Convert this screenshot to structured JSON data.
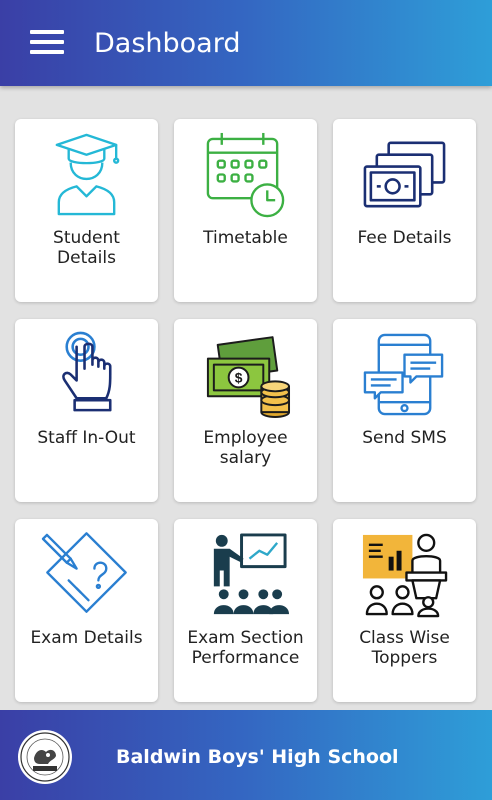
{
  "header": {
    "title": "Dashboard",
    "menu_icon": "hamburger-menu-icon"
  },
  "tiles": [
    {
      "label": "Student\nDetails",
      "icon": "student-graduate-icon"
    },
    {
      "label": "Timetable",
      "icon": "calendar-clock-icon"
    },
    {
      "label": "Fee Details",
      "icon": "money-bills-icon"
    },
    {
      "label": "Staff In-Out",
      "icon": "finger-touch-icon"
    },
    {
      "label": "Employee\nsalary",
      "icon": "cash-coins-icon"
    },
    {
      "label": "Send SMS",
      "icon": "mobile-chat-icon"
    },
    {
      "label": "Exam Details",
      "icon": "exam-pencil-icon"
    },
    {
      "label": "Exam Section\nPerformance",
      "icon": "presentation-audience-icon"
    },
    {
      "label": "Class Wise\nToppers",
      "icon": "classroom-lectern-icon"
    }
  ],
  "footer": {
    "school_name": "Baldwin Boys' High School",
    "logo_icon": "school-crest-icon"
  },
  "colors": {
    "header_start": "#3a3fa6",
    "header_end": "#2e9ed8",
    "icon_teal": "#24b8d6",
    "icon_green": "#3cb043",
    "icon_navy": "#1b2f73",
    "icon_blue": "#2a7fd1"
  }
}
